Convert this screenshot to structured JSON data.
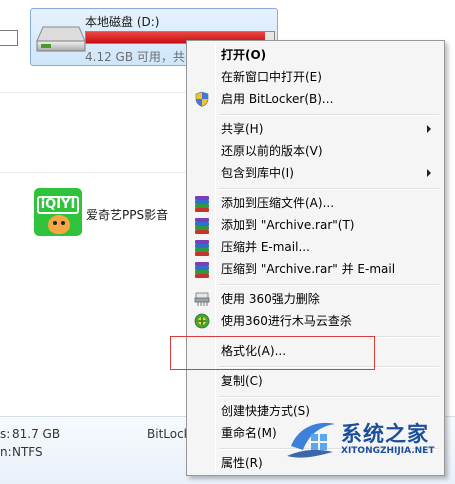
{
  "drive": {
    "name": "本地磁盘 (D:)",
    "free_text": "4.12 GB 可用，共",
    "used_fraction": 0.95,
    "bar_color": "#d61f1f"
  },
  "app": {
    "label": "爱奇艺PPS影音",
    "icon_text": "iQIYI",
    "icon_color": "#2ec33a"
  },
  "details": {
    "size_label": "s:",
    "size_value": "81.7 GB",
    "fs_label": "n:",
    "fs_value": "NTFS",
    "bitlocker_label": "BitLocker"
  },
  "context_menu": {
    "items": [
      {
        "label": "打开(O)",
        "bold": true,
        "icon": "",
        "submenu": false
      },
      {
        "label": "在新窗口中打开(E)",
        "icon": "",
        "submenu": false
      },
      {
        "label": "启用 BitLocker(B)...",
        "icon": "uac-shield-icon",
        "submenu": false
      },
      {
        "label": "共享(H)",
        "icon": "",
        "submenu": true
      },
      {
        "label": "还原以前的版本(V)",
        "icon": "",
        "submenu": false
      },
      {
        "label": "包含到库中(I)",
        "icon": "",
        "submenu": true
      },
      {
        "label": "添加到压缩文件(A)...",
        "icon": "winrar-icon",
        "submenu": false
      },
      {
        "label": "添加到 \"Archive.rar\"(T)",
        "icon": "winrar-icon",
        "submenu": false
      },
      {
        "label": "压缩并 E-mail...",
        "icon": "winrar-icon",
        "submenu": false
      },
      {
        "label": "压缩到 \"Archive.rar\" 并 E-mail",
        "icon": "winrar-icon",
        "submenu": false
      },
      {
        "label": "使用 360强力删除",
        "icon": "shredder-icon",
        "submenu": false
      },
      {
        "label": "使用360进行木马云查杀",
        "icon": "360-icon",
        "submenu": false
      },
      {
        "label": "格式化(A)...",
        "icon": "",
        "submenu": false
      },
      {
        "label": "复制(C)",
        "icon": "",
        "submenu": false
      },
      {
        "label": "创建快捷方式(S)",
        "icon": "",
        "submenu": false
      },
      {
        "label": "重命名(M)",
        "icon": "",
        "submenu": false
      },
      {
        "label": "属性(R)",
        "icon": "",
        "submenu": false
      }
    ]
  },
  "watermark": {
    "text": "系统之家",
    "url": "XITONGZHIJIA.NET"
  },
  "colors": {
    "highlight_box": "#e03b3b",
    "watermark": "#1a4f9c"
  }
}
